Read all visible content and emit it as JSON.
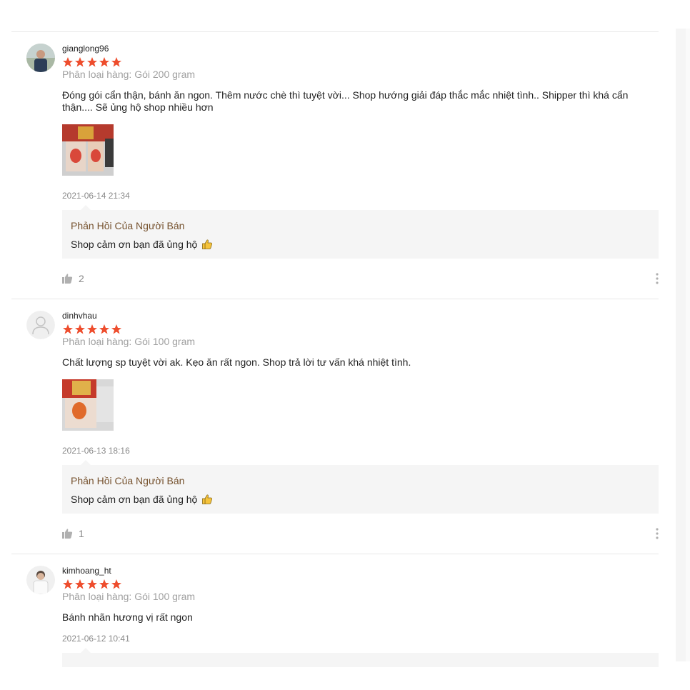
{
  "reviews": [
    {
      "username": "gianglong96",
      "rating": 5,
      "variant": "Phân loại hàng: Gói 200 gram",
      "comment": "Đóng gói cẩn thận, bánh ăn ngon. Thêm nước chè thì tuyệt vời... Shop hướng giải đáp thắc mắc nhiệt tình.. Shipper thì khá cẩn thận.... Sẽ ủng hộ shop nhiều hơn",
      "date": "2021-06-14 21:34",
      "reply_title": "Phản Hồi Của Người Bán",
      "reply_text": "Shop cảm ơn bạn đã ủng hộ",
      "likes": "2"
    },
    {
      "username": "dinhvhau",
      "rating": 5,
      "variant": "Phân loại hàng: Gói 100 gram",
      "comment": "Chất lượng sp tuyệt vời ak. Kẹo ăn rất ngon. Shop trả lời tư vấn khá nhiệt tình.",
      "date": "2021-06-13 18:16",
      "reply_title": "Phản Hồi Của Người Bán",
      "reply_text": "Shop cảm ơn bạn đã ủng hộ",
      "likes": "1"
    },
    {
      "username": "kimhoang_ht",
      "rating": 5,
      "variant": "Phân loại hàng: Gói 100 gram",
      "comment": "Bánh nhãn hương vị rất ngon",
      "date": "2021-06-12 10:41"
    }
  ],
  "colors": {
    "star": "#ee4d2d",
    "reply_title": "#75512d",
    "muted_text": "#8a8a8a",
    "reply_bg": "#f5f5f5"
  },
  "icons": {
    "star": "star-icon",
    "like": "thumbs-up-icon",
    "more": "more-vertical-icon",
    "emoji": "thumbs-up-emoji-icon",
    "default_avatar": "user-icon"
  }
}
